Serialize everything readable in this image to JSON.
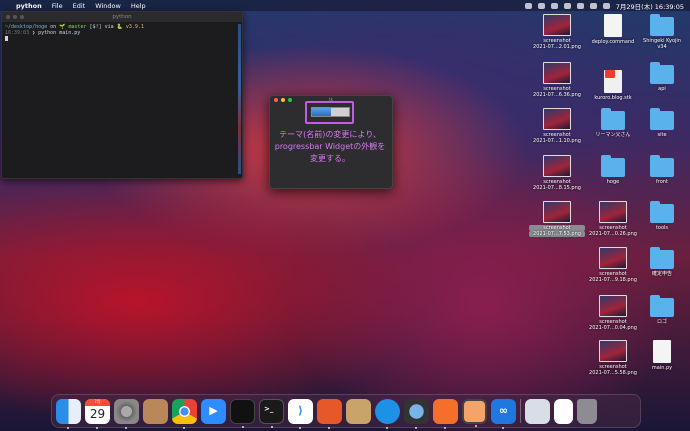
{
  "menubar": {
    "apple_glyph": "",
    "items": [
      "python",
      "File",
      "Edit",
      "Window",
      "Help"
    ],
    "clock": "7月29日(木)  16:39:05"
  },
  "terminal": {
    "title": "python",
    "line1_path": "~/desktop/hoge",
    "line1_on": "on",
    "line1_branch": "🌱 master",
    "line1_status": "[$!]",
    "line1_via": "via",
    "line1_version": "🐍 v3.9.1",
    "line2_time": "16:39:03",
    "line2_cmd": "❯ python main.py"
  },
  "tk_window": {
    "title": "tk",
    "progress": 0.5,
    "annotation": "テーマ(名前)の変更により、progressbar Widgetの外観を変更する。"
  },
  "desktop": {
    "icons": [
      {
        "name": "screenshot-1",
        "line1": "screenshot",
        "line2": "2021-07...2.01.png",
        "type": "shot"
      },
      {
        "name": "deploy-command",
        "line1": "deploy.command",
        "line2": "",
        "type": "doc"
      },
      {
        "name": "shingeki-kyojin",
        "line1": "Shingeki Kyojin",
        "line2": "v34",
        "type": "folder"
      },
      {
        "name": "screenshot-2",
        "line1": "screenshot",
        "line2": "2021-07...6.36.png",
        "type": "shot"
      },
      {
        "name": "kuroro-blog",
        "line1": "kuroro.blog.stk",
        "line2": "",
        "type": "pdf"
      },
      {
        "name": "api",
        "line1": "api",
        "line2": "",
        "type": "folder"
      },
      {
        "name": "screenshot-3",
        "line1": "screenshot",
        "line2": "2021-07...1.10.png",
        "type": "shot"
      },
      {
        "name": "riemann",
        "line1": "リーマン父さん",
        "line2": "",
        "type": "folder"
      },
      {
        "name": "site",
        "line1": "site",
        "line2": "",
        "type": "folder"
      },
      {
        "name": "screenshot-4",
        "line1": "screenshot",
        "line2": "2021-07...8.15.png",
        "type": "shot"
      },
      {
        "name": "hoge",
        "line1": "hoge",
        "line2": "",
        "type": "folder"
      },
      {
        "name": "front",
        "line1": "front",
        "line2": "",
        "type": "folder"
      },
      {
        "name": "screenshot-5",
        "line1": "screenshot",
        "line2": "2021-07...7.53.png",
        "type": "shot"
      },
      {
        "name": "screenshot-6",
        "line1": "screenshot",
        "line2": "2021-07...0.26.png",
        "type": "shot"
      },
      {
        "name": "tools",
        "line1": "tools",
        "line2": "",
        "type": "folder"
      },
      {
        "name": "screenshot-7",
        "line1": "screenshot",
        "line2": "2021-07...9.18.png",
        "type": "shot"
      },
      {
        "name": "kakutei-shinkoku",
        "line1": "確定申告",
        "line2": "",
        "type": "folder"
      },
      {
        "name": "screenshot-8",
        "line1": "screenshot",
        "line2": "2021-07...0.04.png",
        "type": "shot"
      },
      {
        "name": "logo",
        "line1": "ロゴ",
        "line2": "",
        "type": "folder"
      },
      {
        "name": "screenshot-9",
        "line1": "screenshot",
        "line2": "2021-07...5.58.png",
        "type": "shot"
      },
      {
        "name": "main-py",
        "line1": "main.py",
        "line2": "",
        "type": "doc"
      }
    ]
  },
  "dock": {
    "calendar_day": "29",
    "calendar_month": "7月",
    "apps": [
      "finder",
      "calendar",
      "system-preferences",
      "contacts",
      "chrome",
      "zoom",
      "activity-monitor",
      "terminal",
      "vscode",
      "instruments",
      "archive",
      "docker",
      "quicktime",
      "git",
      "sublime",
      "infinity",
      "preview",
      "document",
      "trash"
    ]
  },
  "colors": {
    "accent": "#c05ee6",
    "annotation": "#d77af0",
    "folder": "#5ab2ec"
  }
}
